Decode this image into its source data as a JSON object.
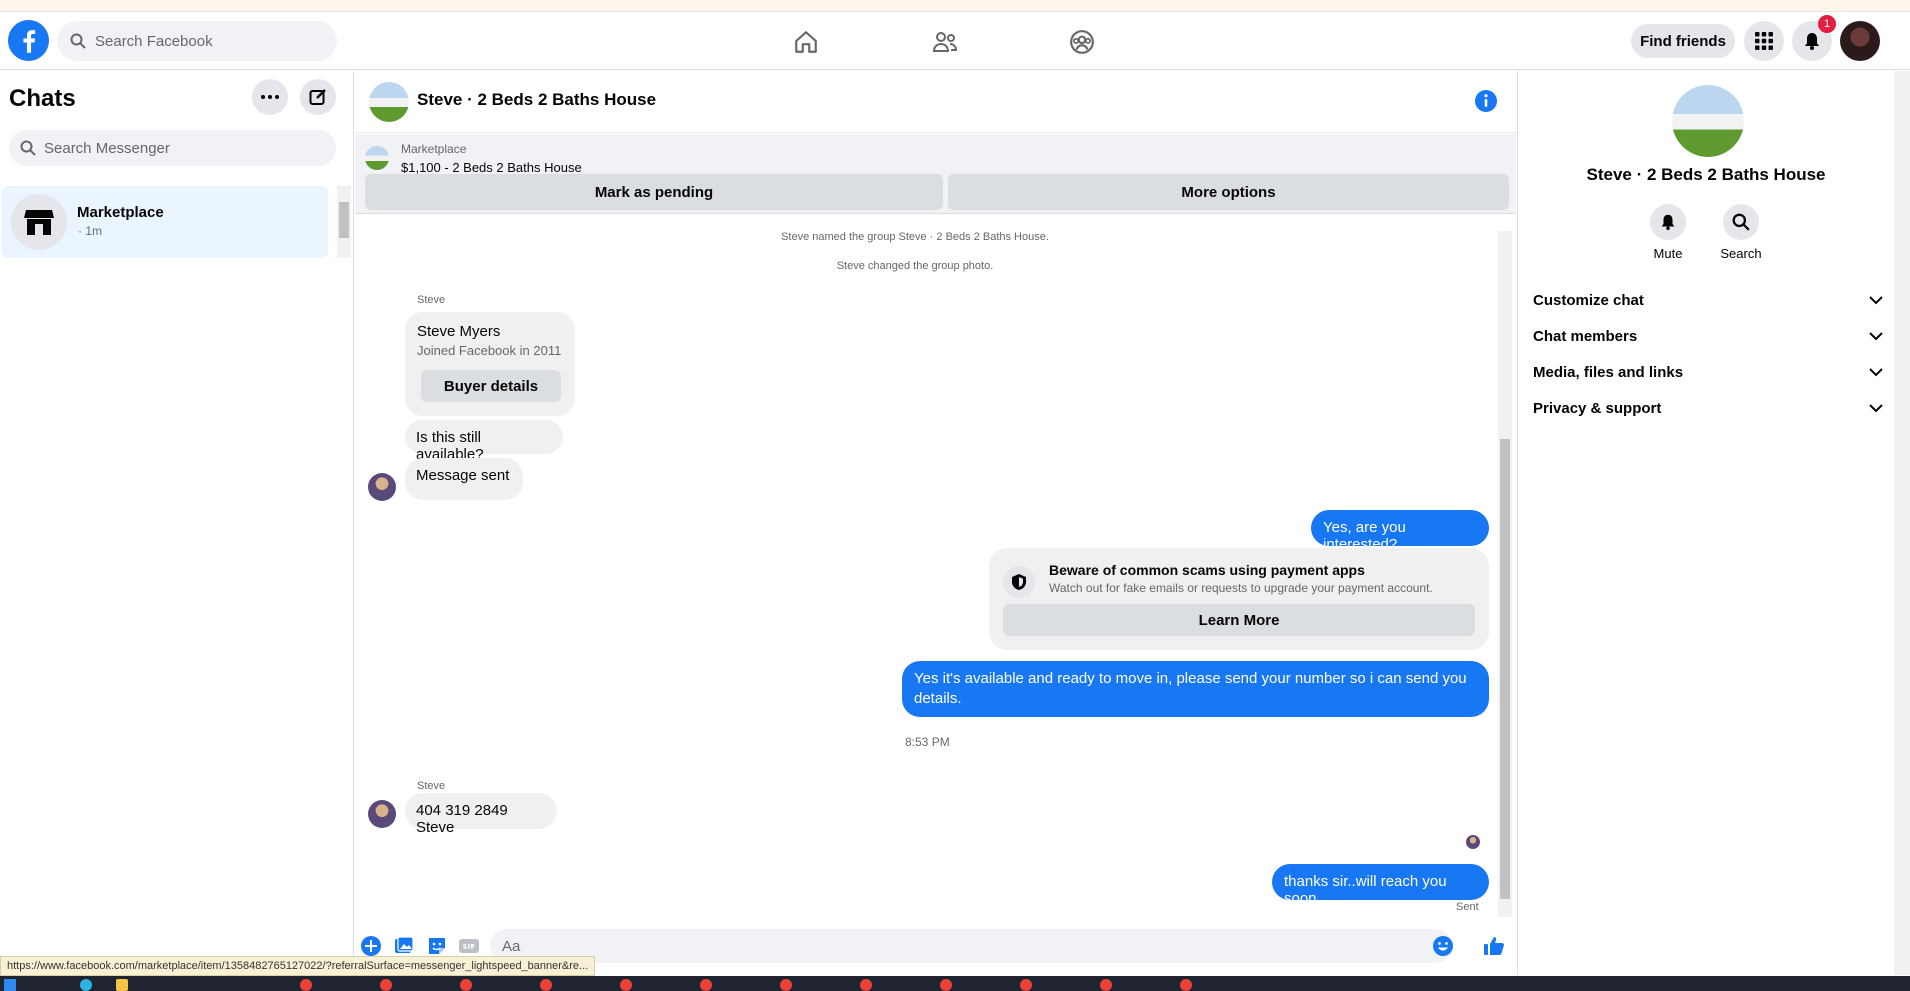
{
  "topbar": {
    "search_placeholder": "Search Facebook",
    "find_friends": "Find friends",
    "notification_count": "1",
    "accent": "#1877f2"
  },
  "left": {
    "title": "Chats",
    "search_placeholder": "Search Messenger",
    "chats": [
      {
        "name": "Marketplace",
        "time": "· 1m"
      }
    ]
  },
  "conversation": {
    "title": "Steve · 2 Beds 2 Baths House",
    "marketplace_label": "Marketplace",
    "listing": "$1,100 - 2 Beds 2 Baths House",
    "mark_pending": "Mark as pending",
    "more_options": "More options",
    "system_messages": [
      "Steve named the group Steve · 2 Beds 2 Baths House.",
      "Steve changed the group photo."
    ],
    "sender": "Steve",
    "buyer_card": {
      "name": "Steve Myers",
      "joined": "Joined Facebook in 2011",
      "button": "Buyer details"
    },
    "messages": {
      "in_1": "Is this still available?",
      "in_2": "Message sent",
      "out_1": "Yes, are you interested?",
      "out_2": "Yes it's available and ready to move in, please send your number so i can send you details.",
      "time": "8:53 PM",
      "sender_2": "Steve",
      "in_3": "404 319 2849 Steve",
      "out_3": "thanks sir..will reach you soon",
      "status": "Sent"
    },
    "scam_card": {
      "title": "Beware of common scams using payment apps",
      "body": "Watch out for fake emails or requests to upgrade your payment account.",
      "button": "Learn More"
    },
    "composer_placeholder": "Aa"
  },
  "right": {
    "name": "Steve · 2 Beds 2 Baths House",
    "mute": "Mute",
    "search": "Search",
    "sections": [
      "Customize chat",
      "Chat members",
      "Media, files and links",
      "Privacy & support"
    ]
  },
  "status_url": "https://www.facebook.com/marketplace/item/1358482765127022/?referralSurface=messenger_lightspeed_banner&re..."
}
